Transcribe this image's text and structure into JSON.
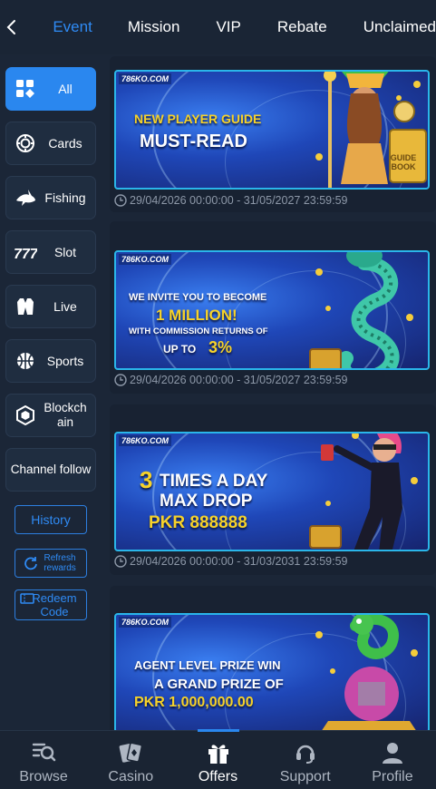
{
  "top_nav": {
    "tabs": [
      {
        "label": "Event",
        "active": true
      },
      {
        "label": "Mission",
        "active": false
      },
      {
        "label": "VIP",
        "active": false
      },
      {
        "label": "Rebate",
        "active": false
      },
      {
        "label": "Unclaimed",
        "active": false
      }
    ]
  },
  "sidebar": {
    "items": [
      {
        "label": "All",
        "icon": "grid-icon",
        "active": true
      },
      {
        "label": "Cards",
        "icon": "chip-icon",
        "active": false
      },
      {
        "label": "Fishing",
        "icon": "shark-icon",
        "active": false
      },
      {
        "label": "Slot",
        "icon": "slot-777-icon",
        "active": false
      },
      {
        "label": "Live",
        "icon": "vest-icon",
        "active": false
      },
      {
        "label": "Sports",
        "icon": "basketball-icon",
        "active": false
      },
      {
        "label": "Blockchain",
        "icon": "cube-icon",
        "active": false
      },
      {
        "label": "Channel follow",
        "icon": "",
        "active": false
      }
    ],
    "history_label": "History",
    "refresh_label": "Refresh rewards",
    "redeem_label": "Redeem Code"
  },
  "promotions": [
    {
      "brand": "786KO.COM",
      "lines": [
        "NEW PLAYER GUIDE",
        "MUST-READ"
      ],
      "book_text": "GUIDE BOOK",
      "date_range": "29/04/2026 00:00:00 - 31/05/2027 23:59:59"
    },
    {
      "brand": "786KO.COM",
      "lines": [
        "WE INVITE YOU TO BECOME",
        "1 MILLION!",
        "WITH COMMISSION RETURNS OF",
        "UP TO",
        "3%"
      ],
      "date_range": "29/04/2026 00:00:00 - 31/05/2027 23:59:59"
    },
    {
      "brand": "786KO.COM",
      "lines": [
        "3",
        "TIMES A DAY",
        "MAX DROP",
        "PKR 888888"
      ],
      "date_range": "29/04/2026 00:00:00 - 31/03/2031 23:59:59"
    },
    {
      "brand": "786KO.COM",
      "lines": [
        "AGENT LEVEL PRIZE WIN",
        "A GRAND PRIZE OF",
        "PKR 1,000,000.00"
      ],
      "date_range": ""
    }
  ],
  "bottom_nav": {
    "items": [
      {
        "label": "Browse",
        "icon": "browse-search-icon",
        "active": false
      },
      {
        "label": "Casino",
        "icon": "cards-icon",
        "active": false
      },
      {
        "label": "Offers",
        "icon": "gift-icon",
        "active": true
      },
      {
        "label": "Support",
        "icon": "headset-icon",
        "active": false
      },
      {
        "label": "Profile",
        "icon": "user-icon",
        "active": false
      }
    ]
  },
  "colors": {
    "accent": "#2a87ef",
    "background": "#1b2637",
    "banner_border": "#2ab6ea",
    "promo_yellow": "#f6d22a"
  }
}
